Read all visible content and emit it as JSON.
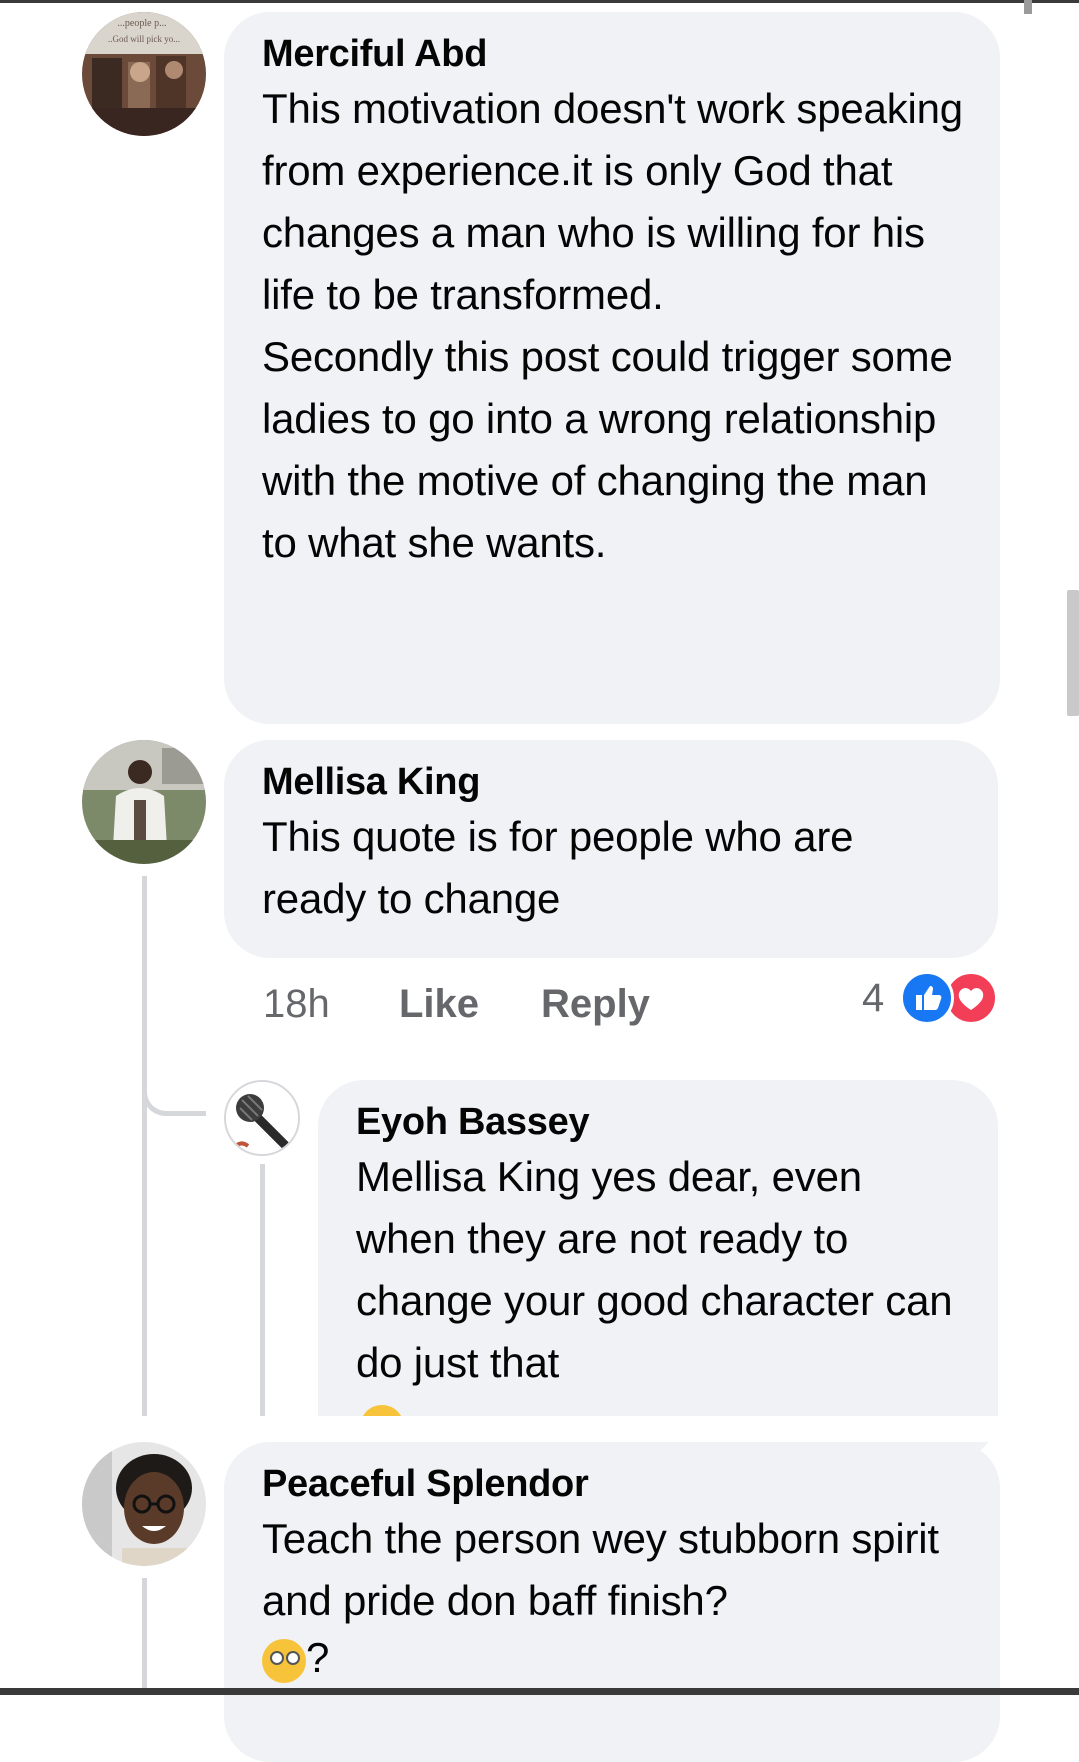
{
  "comments": [
    {
      "author": "Merciful Abd",
      "paragraphs": [
        "This motivation doesn't work speaking from experience.it is only God that changes a man who is willing for his life to be transformed.",
        "Secondly this post could trigger some ladies to go into a wrong relationship with the motive of changing the man to what she wants."
      ],
      "avatar_caption_1": "...people p...",
      "avatar_caption_2": "..God will pick yo..."
    },
    {
      "author": "Mellisa King",
      "paragraphs": [
        "This quote is for people who are ready to change"
      ],
      "time": "18h",
      "like_label": "Like",
      "reply_label": "Reply",
      "reaction_count": "4",
      "reactions": [
        "like-icon",
        "love-icon"
      ]
    },
    {
      "author": "Eyoh Bassey",
      "paragraphs": [
        "Mellisa King yes dear, even when they are not ready to change your good character can do just that"
      ]
    },
    {
      "author": "Peaceful Splendor",
      "paragraphs": [
        "Teach the person wey stubborn spirit and pride don baff finish?"
      ],
      "tail": "?"
    }
  ],
  "colors": {
    "bubble": "#f0f2f5",
    "meta_text": "#65676b",
    "like_blue": "#1877f2",
    "love_red": "#f33e58",
    "thread_line": "#d5d7db"
  }
}
